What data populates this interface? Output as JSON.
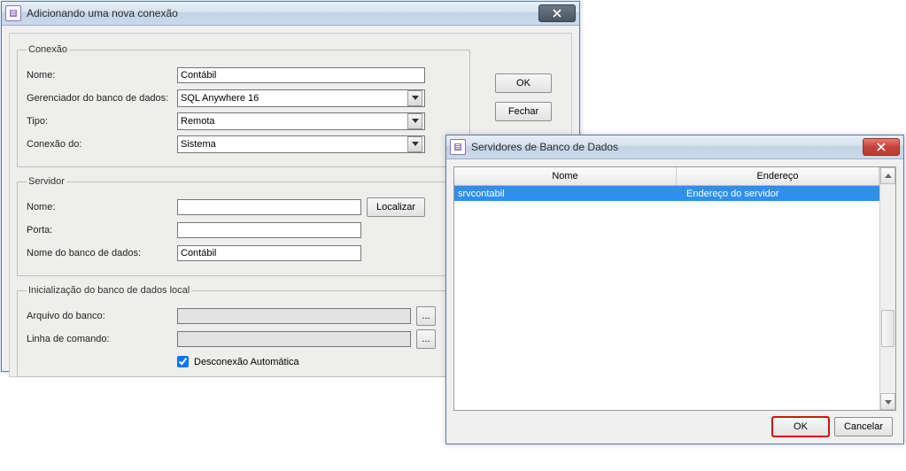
{
  "window1": {
    "title": "Adicionando uma nova conexão",
    "buttons": {
      "ok": "OK",
      "close": "Fechar"
    },
    "conexao": {
      "legend": "Conexão",
      "nome_label": "Nome:",
      "nome_value": "Contábil",
      "gerenciador_label": "Gerenciador do banco de dados:",
      "gerenciador_value": "SQL Anywhere 16",
      "tipo_label": "Tipo:",
      "tipo_value": "Remota",
      "conexao_do_label": "Conexão do:",
      "conexao_do_value": "Sistema"
    },
    "servidor": {
      "legend": "Servidor",
      "nome_label": "Nome:",
      "nome_value": "",
      "localizar": "Localizar",
      "porta_label": "Porta:",
      "porta_value": "",
      "banco_label": "Nome do banco de dados:",
      "banco_value": "Contábil"
    },
    "inicializacao": {
      "legend": "Inicialização do banco de dados local",
      "arquivo_label": "Arquivo do banco:",
      "arquivo_value": "",
      "browse": "...",
      "linha_label": "Linha de comando:",
      "linha_value": "",
      "desconexao_label": "Desconexão Automática",
      "desconexao_checked": true
    }
  },
  "window2": {
    "title": "Servidores de Banco de Dados",
    "columns": {
      "nome": "Nome",
      "endereco": "Endereço"
    },
    "rows": [
      {
        "nome": "srvcontabil",
        "endereco": "Endereço do servidor",
        "selected": true
      }
    ],
    "buttons": {
      "ok": "OK",
      "cancel": "Cancelar"
    }
  }
}
